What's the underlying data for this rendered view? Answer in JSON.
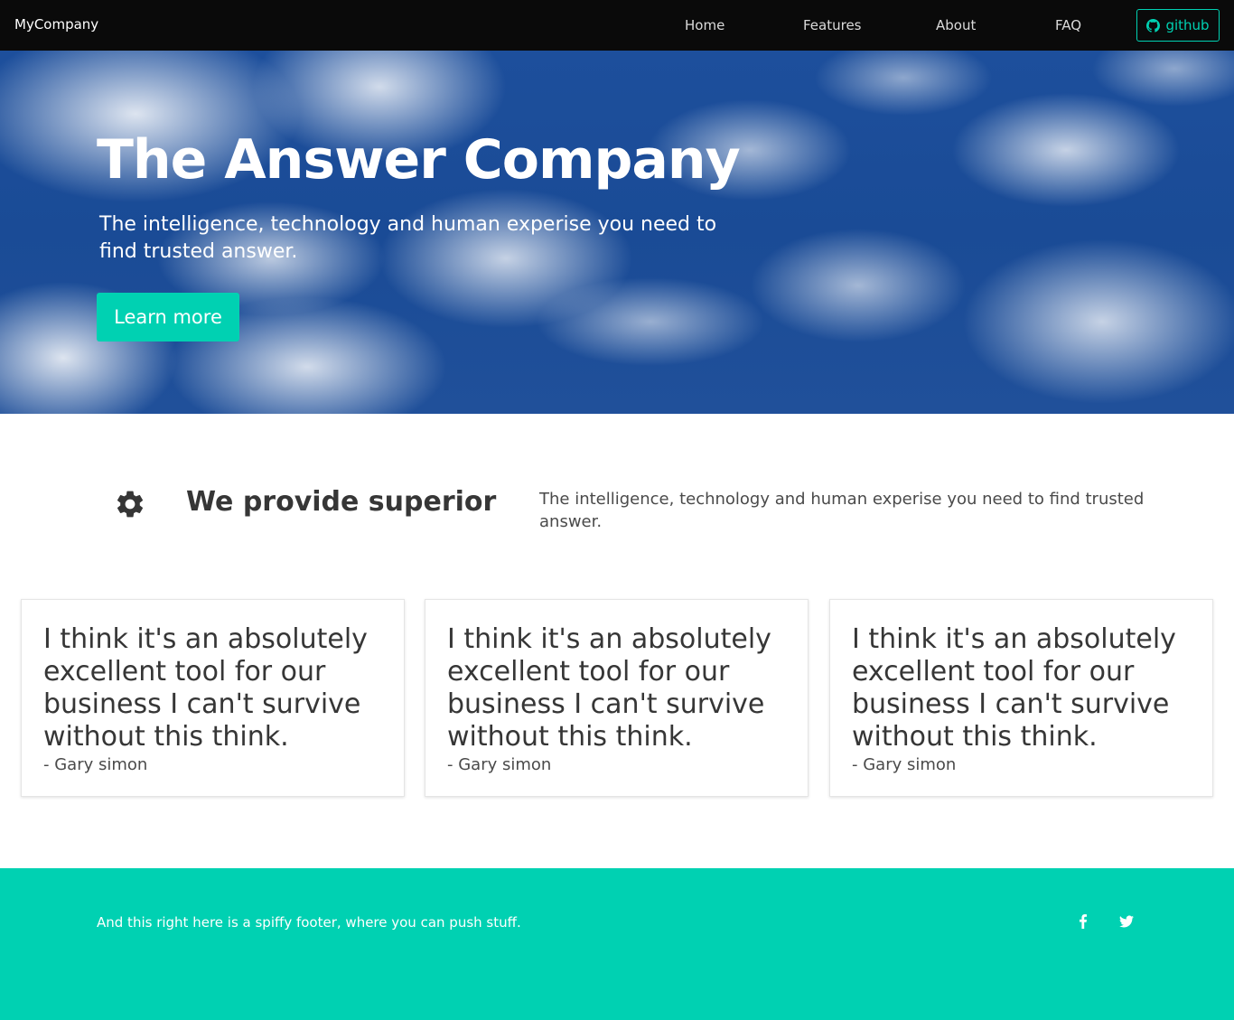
{
  "navbar": {
    "brand": "MyCompany",
    "items": [
      {
        "label": "Home"
      },
      {
        "label": "Features"
      },
      {
        "label": "About"
      },
      {
        "label": "FAQ"
      }
    ],
    "github_label": "github"
  },
  "hero": {
    "title": "The Answer Company",
    "subtitle": "The intelligence, technology and human experise you need to find trusted answer.",
    "button_label": "Learn more"
  },
  "feature": {
    "icon": "gear-icon",
    "heading": "We provide superior",
    "text": "The intelligence, technology and human experise you need to find trusted answer."
  },
  "testimonials": [
    {
      "quote": "I think it's an absolutely excellent tool for our business I can't survive without this think.",
      "author": "- Gary simon"
    },
    {
      "quote": "I think it's an absolutely excellent tool for our business I can't survive without this think.",
      "author": "- Gary simon"
    },
    {
      "quote": "I think it's an absolutely excellent tool for our business I can't survive without this think.",
      "author": "- Gary simon"
    }
  ],
  "footer": {
    "text": "And this right here is a spiffy footer, where you can push stuff.",
    "social": [
      "facebook-icon",
      "twitter-icon"
    ]
  },
  "colors": {
    "primary": "#00d1b2",
    "navbar": "#0a0a0a",
    "text": "#363636"
  }
}
